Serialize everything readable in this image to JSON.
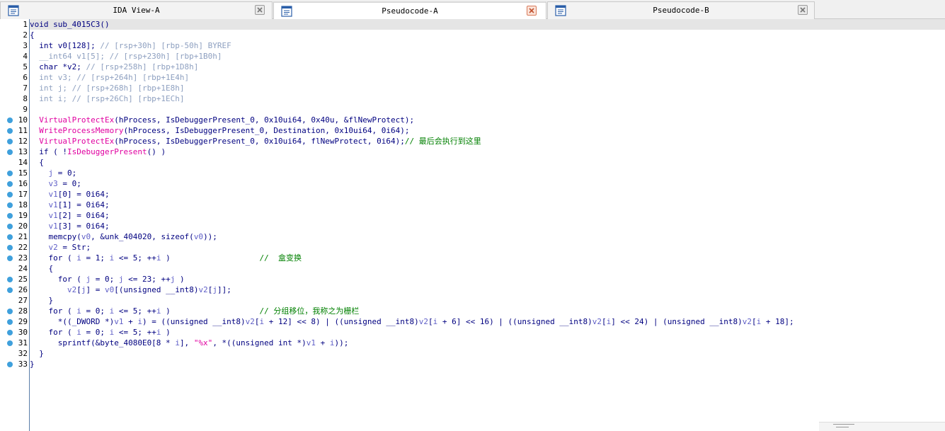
{
  "tabs": [
    {
      "title": "IDA View-A",
      "active": false
    },
    {
      "title": "Pseudocode-A",
      "active": true
    },
    {
      "title": "Pseudocode-B",
      "active": false
    }
  ],
  "colors": {
    "gutter_dot": "#3fa0dc",
    "active_close": "#d87a5a",
    "keyword": "#000080",
    "comment": "#008000",
    "function_call": "#e000a0",
    "variable": "#6060c8",
    "stack_comment": "#8ea0c0"
  },
  "lines": [
    {
      "n": "1",
      "dot": false,
      "tokens": [
        [
          "n",
          "void sub_4015C3()"
        ]
      ]
    },
    {
      "n": "2",
      "dot": false,
      "tokens": [
        [
          "n",
          "{"
        ]
      ]
    },
    {
      "n": "3",
      "dot": false,
      "tokens": [
        [
          "n",
          "  int v0[128]; "
        ],
        [
          "g",
          "// [rsp+30h] [rbp-50h] BYREF"
        ]
      ]
    },
    {
      "n": "4",
      "dot": false,
      "tokens": [
        [
          "g",
          "  __int64 v1[5]; // [rsp+230h] [rbp+1B0h]"
        ]
      ]
    },
    {
      "n": "5",
      "dot": false,
      "tokens": [
        [
          "n",
          "  char *v2; "
        ],
        [
          "g",
          "// [rsp+258h] [rbp+1D8h]"
        ]
      ]
    },
    {
      "n": "6",
      "dot": false,
      "tokens": [
        [
          "g",
          "  int v3; // [rsp+264h] [rbp+1E4h]"
        ]
      ]
    },
    {
      "n": "7",
      "dot": false,
      "tokens": [
        [
          "g",
          "  int j; // [rsp+268h] [rbp+1E8h]"
        ]
      ]
    },
    {
      "n": "8",
      "dot": false,
      "tokens": [
        [
          "g",
          "  int i; // [rsp+26Ch] [rbp+1ECh]"
        ]
      ]
    },
    {
      "n": "9",
      "dot": false,
      "tokens": [
        [
          "n",
          ""
        ]
      ]
    },
    {
      "n": "10",
      "dot": true,
      "tokens": [
        [
          "n",
          "  "
        ],
        [
          "f",
          "VirtualProtectEx"
        ],
        [
          "n",
          "(hProcess, IsDebuggerPresent_0, 0x10ui64, 0x40u, &flNewProtect);"
        ]
      ]
    },
    {
      "n": "11",
      "dot": true,
      "tokens": [
        [
          "n",
          "  "
        ],
        [
          "f",
          "WriteProcessMemory"
        ],
        [
          "n",
          "(hProcess, IsDebuggerPresent_0, Destination, 0x10ui64, 0i64);"
        ]
      ]
    },
    {
      "n": "12",
      "dot": true,
      "tokens": [
        [
          "n",
          "  "
        ],
        [
          "f",
          "VirtualProtectEx"
        ],
        [
          "n",
          "(hProcess, IsDebuggerPresent_0, 0x10ui64, flNewProtect, 0i64);"
        ],
        [
          "c",
          "// 最后会执行到这里"
        ]
      ]
    },
    {
      "n": "13",
      "dot": true,
      "tokens": [
        [
          "n",
          "  if ( !"
        ],
        [
          "f",
          "IsDebuggerPresent"
        ],
        [
          "n",
          "() )"
        ]
      ]
    },
    {
      "n": "14",
      "dot": false,
      "tokens": [
        [
          "n",
          "  {"
        ]
      ]
    },
    {
      "n": "15",
      "dot": true,
      "tokens": [
        [
          "n",
          "    "
        ],
        [
          "v",
          "j"
        ],
        [
          "n",
          " = 0;"
        ]
      ]
    },
    {
      "n": "16",
      "dot": true,
      "tokens": [
        [
          "n",
          "    "
        ],
        [
          "v",
          "v3"
        ],
        [
          "n",
          " = 0;"
        ]
      ]
    },
    {
      "n": "17",
      "dot": true,
      "tokens": [
        [
          "n",
          "    "
        ],
        [
          "v",
          "v1"
        ],
        [
          "n",
          "[0] = 0i64;"
        ]
      ]
    },
    {
      "n": "18",
      "dot": true,
      "tokens": [
        [
          "n",
          "    "
        ],
        [
          "v",
          "v1"
        ],
        [
          "n",
          "[1] = 0i64;"
        ]
      ]
    },
    {
      "n": "19",
      "dot": true,
      "tokens": [
        [
          "n",
          "    "
        ],
        [
          "v",
          "v1"
        ],
        [
          "n",
          "[2] = 0i64;"
        ]
      ]
    },
    {
      "n": "20",
      "dot": true,
      "tokens": [
        [
          "n",
          "    "
        ],
        [
          "v",
          "v1"
        ],
        [
          "n",
          "[3] = 0i64;"
        ]
      ]
    },
    {
      "n": "21",
      "dot": true,
      "tokens": [
        [
          "n",
          "    memcpy("
        ],
        [
          "v",
          "v0"
        ],
        [
          "n",
          ", &unk_404020, sizeof("
        ],
        [
          "v",
          "v0"
        ],
        [
          "n",
          "));"
        ]
      ]
    },
    {
      "n": "22",
      "dot": true,
      "tokens": [
        [
          "n",
          "    "
        ],
        [
          "v",
          "v2"
        ],
        [
          "n",
          " = Str;"
        ]
      ]
    },
    {
      "n": "23",
      "dot": true,
      "tokens": [
        [
          "n",
          "    for ( "
        ],
        [
          "v",
          "i"
        ],
        [
          "n",
          " = 1; "
        ],
        [
          "v",
          "i"
        ],
        [
          "n",
          " <= 5; ++"
        ],
        [
          "v",
          "i"
        ],
        [
          "n",
          " )                   "
        ],
        [
          "c",
          "//  盒变换"
        ]
      ]
    },
    {
      "n": "24",
      "dot": false,
      "tokens": [
        [
          "n",
          "    {"
        ]
      ]
    },
    {
      "n": "25",
      "dot": true,
      "tokens": [
        [
          "n",
          "      for ( "
        ],
        [
          "v",
          "j"
        ],
        [
          "n",
          " = 0; "
        ],
        [
          "v",
          "j"
        ],
        [
          "n",
          " <= 23; ++"
        ],
        [
          "v",
          "j"
        ],
        [
          "n",
          " )"
        ]
      ]
    },
    {
      "n": "26",
      "dot": true,
      "tokens": [
        [
          "n",
          "        "
        ],
        [
          "v",
          "v2"
        ],
        [
          "n",
          "["
        ],
        [
          "v",
          "j"
        ],
        [
          "n",
          "] = "
        ],
        [
          "v",
          "v0"
        ],
        [
          "n",
          "[(unsigned __int8)"
        ],
        [
          "v",
          "v2"
        ],
        [
          "n",
          "["
        ],
        [
          "v",
          "j"
        ],
        [
          "n",
          "]];"
        ]
      ]
    },
    {
      "n": "27",
      "dot": false,
      "tokens": [
        [
          "n",
          "    }"
        ]
      ]
    },
    {
      "n": "28",
      "dot": true,
      "tokens": [
        [
          "n",
          "    for ( "
        ],
        [
          "v",
          "i"
        ],
        [
          "n",
          " = 0; "
        ],
        [
          "v",
          "i"
        ],
        [
          "n",
          " <= 5; ++"
        ],
        [
          "v",
          "i"
        ],
        [
          "n",
          " )                   "
        ],
        [
          "c",
          "// 分组移位，我称之为栅栏"
        ]
      ]
    },
    {
      "n": "29",
      "dot": true,
      "tokens": [
        [
          "n",
          "      *((_DWORD *)"
        ],
        [
          "v",
          "v1"
        ],
        [
          "n",
          " + "
        ],
        [
          "v",
          "i"
        ],
        [
          "n",
          ") = ((unsigned __int8)"
        ],
        [
          "v",
          "v2"
        ],
        [
          "n",
          "["
        ],
        [
          "v",
          "i"
        ],
        [
          "n",
          " + 12] << 8) | ((unsigned __int8)"
        ],
        [
          "v",
          "v2"
        ],
        [
          "n",
          "["
        ],
        [
          "v",
          "i"
        ],
        [
          "n",
          " + 6] << 16) | ((unsigned __int8)"
        ],
        [
          "v",
          "v2"
        ],
        [
          "n",
          "["
        ],
        [
          "v",
          "i"
        ],
        [
          "n",
          "] << 24) | (unsigned __int8)"
        ],
        [
          "v",
          "v2"
        ],
        [
          "n",
          "["
        ],
        [
          "v",
          "i"
        ],
        [
          "n",
          " + 18];"
        ]
      ]
    },
    {
      "n": "30",
      "dot": true,
      "tokens": [
        [
          "n",
          "    for ( "
        ],
        [
          "v",
          "i"
        ],
        [
          "n",
          " = 0; "
        ],
        [
          "v",
          "i"
        ],
        [
          "n",
          " <= 5; ++"
        ],
        [
          "v",
          "i"
        ],
        [
          "n",
          " )"
        ]
      ]
    },
    {
      "n": "31",
      "dot": true,
      "tokens": [
        [
          "n",
          "      sprintf(&byte_4080E0[8 * "
        ],
        [
          "v",
          "i"
        ],
        [
          "n",
          "], "
        ],
        [
          "f",
          "\"%x\""
        ],
        [
          "n",
          ", *((unsigned int *)"
        ],
        [
          "v",
          "v1"
        ],
        [
          "n",
          " + "
        ],
        [
          "v",
          "i"
        ],
        [
          "n",
          "));"
        ]
      ]
    },
    {
      "n": "32",
      "dot": false,
      "tokens": [
        [
          "n",
          "  }"
        ]
      ]
    },
    {
      "n": "33",
      "dot": true,
      "tokens": [
        [
          "n",
          "}"
        ]
      ]
    }
  ]
}
